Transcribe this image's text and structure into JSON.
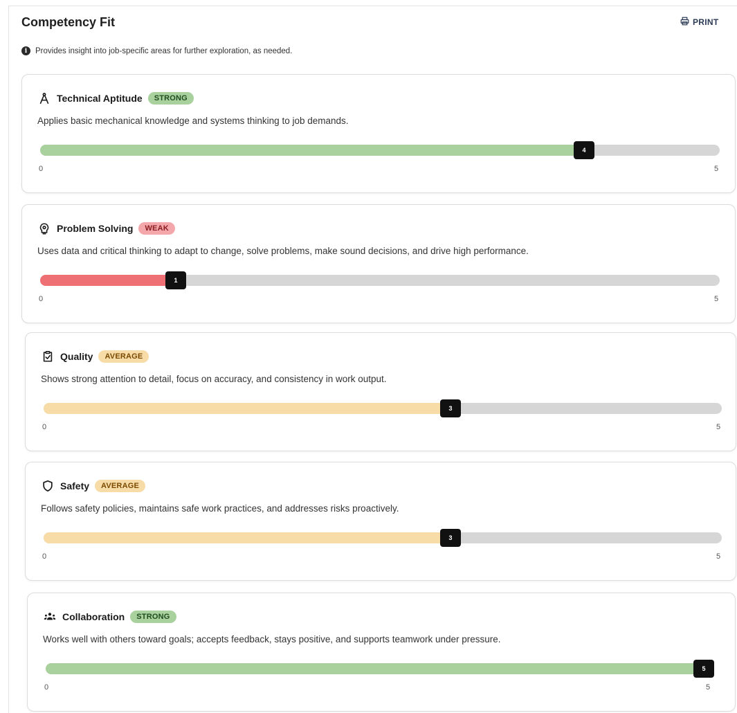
{
  "header": {
    "title": "Competency Fit",
    "print_label": "PRINT",
    "info_text": "Provides insight into job-specific areas for further exploration, as needed."
  },
  "scale": {
    "min": "0",
    "max": "5"
  },
  "colors": {
    "strong_fill": "#a9d19e",
    "strong_badge_bg": "#a9d19e",
    "strong_badge_text": "#1f4d1f",
    "weak_fill": "#ee6f74",
    "weak_badge_bg": "#f4a7aa",
    "weak_badge_text": "#8a1c22",
    "average_fill": "#f8dca8",
    "average_badge_bg": "#f8dca8",
    "average_badge_text": "#7a4a00",
    "track": "#d6d6d6"
  },
  "competencies": [
    {
      "name": "Technical Aptitude",
      "icon": "compass-icon",
      "rating": "STRONG",
      "level": "strong",
      "description": "Applies basic mechanical knowledge and systems thinking to job demands.",
      "score": 4,
      "score_label": "4"
    },
    {
      "name": "Problem Solving",
      "icon": "lightbulb-gear-icon",
      "rating": "WEAK",
      "level": "weak",
      "description": "Uses data and critical thinking to adapt to change, solve problems, make sound decisions, and drive high performance.",
      "score": 1,
      "score_label": "1"
    },
    {
      "name": "Quality",
      "icon": "clipboard-check-icon",
      "rating": "AVERAGE",
      "level": "average",
      "description": "Shows strong attention to detail, focus on accuracy, and consistency in work output.",
      "score": 3,
      "score_label": "3"
    },
    {
      "name": "Safety",
      "icon": "shield-icon",
      "rating": "AVERAGE",
      "level": "average",
      "description": "Follows safety policies, maintains safe work practices, and addresses risks proactively.",
      "score": 3,
      "score_label": "3"
    },
    {
      "name": "Collaboration",
      "icon": "team-icon",
      "rating": "STRONG",
      "level": "strong",
      "description": "Works well with others toward goals; accepts feedback, stays positive, and supports teamwork under pressure.",
      "score": 5,
      "score_label": "5"
    }
  ]
}
